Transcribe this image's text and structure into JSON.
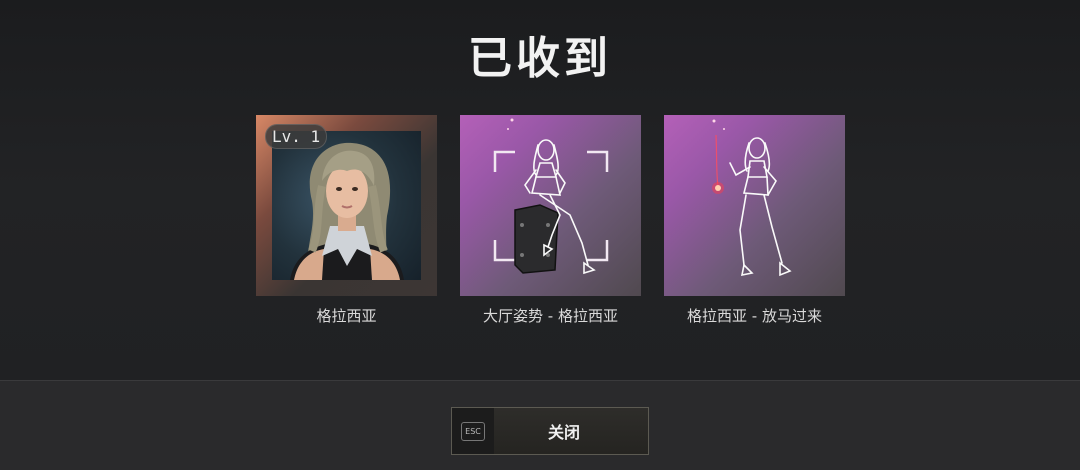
{
  "header": {
    "title": "已收到"
  },
  "rewards": [
    {
      "label": "格拉西亚",
      "badge": "Lv. 1",
      "icon": "character-portrait"
    },
    {
      "label": "大厅姿势 - 格拉西亚",
      "icon": "lobby-pose-sitting"
    },
    {
      "label": "格拉西亚 - 放马过来",
      "icon": "emote-pose-standing"
    }
  ],
  "footer": {
    "close_label": "关闭",
    "esc_key": "ESC"
  }
}
